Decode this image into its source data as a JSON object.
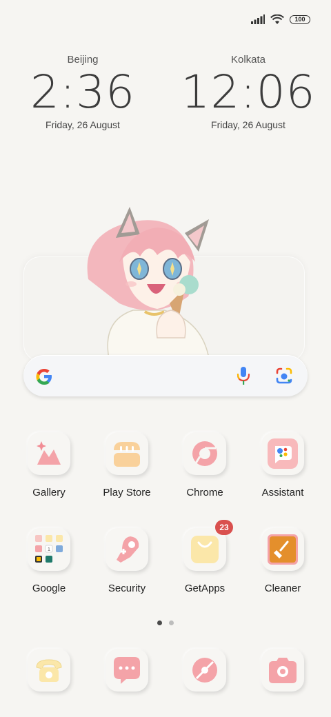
{
  "status_bar": {
    "signal_icon": "signal-bars-icon",
    "wifi_icon": "wifi-icon",
    "battery_level": "100"
  },
  "clocks": [
    {
      "city": "Beijing",
      "time": "2:36",
      "date": "Friday, 26 August"
    },
    {
      "city": "Kolkata",
      "time": "12:06",
      "date": "Friday, 26 August"
    }
  ],
  "widget": {
    "art_icon": "anime-girl-cat-ears-illustration"
  },
  "search": {
    "logo_icon": "google-g-icon",
    "mic_icon": "microphone-icon",
    "lens_icon": "google-lens-icon"
  },
  "apps_row1": [
    {
      "label": "Gallery",
      "icon": "gallery-icon"
    },
    {
      "label": "Play Store",
      "icon": "play-store-icon"
    },
    {
      "label": "Chrome",
      "icon": "chrome-icon"
    },
    {
      "label": "Assistant",
      "icon": "assistant-icon"
    }
  ],
  "apps_row2": [
    {
      "label": "Google",
      "icon": "google-folder-icon"
    },
    {
      "label": "Security",
      "icon": "security-icon"
    },
    {
      "label": "GetApps",
      "icon": "getapps-icon",
      "badge": "23"
    },
    {
      "label": "Cleaner",
      "icon": "cleaner-icon"
    }
  ],
  "page_indicator": {
    "pages": 2,
    "current": 1
  },
  "dock": [
    {
      "icon": "phone-icon"
    },
    {
      "icon": "messages-icon"
    },
    {
      "icon": "browser-icon"
    },
    {
      "icon": "camera-icon"
    }
  ],
  "colors": {
    "background": "#f6f5f2",
    "badge": "#d9504e",
    "pink": "#f4a3a8",
    "yellow": "#fbe7a9"
  }
}
